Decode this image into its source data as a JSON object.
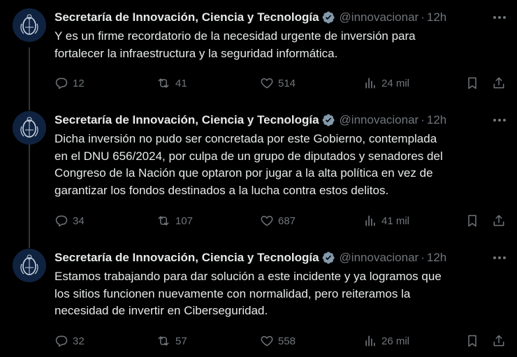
{
  "tweets": [
    {
      "author": "Secretaría de Innovación, Ciencia y Tecnología",
      "handle": "@innovacionar",
      "separator": "·",
      "time": "12h",
      "text": "Y es un firme recordatorio de la necesidad urgente de inversión para\nfortalecer la infraestructura y la seguridad informática.",
      "replies": "12",
      "reposts": "41",
      "likes": "514",
      "views": "24 mil"
    },
    {
      "author": "Secretaría de Innovación, Ciencia y Tecnología",
      "handle": "@innovacionar",
      "separator": "·",
      "time": "12h",
      "text": "Dicha inversión no pudo ser concretada por este Gobierno, contemplada\nen el DNU 656/2024, por culpa de un grupo de diputados y senadores del\nCongreso de la Nación que optaron por jugar a la alta política en vez de\ngarantizar los fondos destinados a la lucha contra estos delitos.",
      "replies": "34",
      "reposts": "107",
      "likes": "687",
      "views": "41 mil"
    },
    {
      "author": "Secretaría de Innovación, Ciencia y Tecnología",
      "handle": "@innovacionar",
      "separator": "·",
      "time": "12h",
      "text": "Estamos trabajando para dar solución a este incidente y ya logramos que\nlos sitios funcionen nuevamente con normalidad, pero reiteramos la\nnecesidad de invertir en Ciberseguridad.",
      "replies": "32",
      "reposts": "57",
      "likes": "558",
      "views": "26 mil"
    }
  ],
  "icons": {
    "verified": "verified-badge-icon",
    "more": "more-options-icon",
    "reply": "reply-icon",
    "repost": "repost-icon",
    "like": "like-icon",
    "views": "views-icon",
    "bookmark": "bookmark-icon",
    "share": "share-icon"
  },
  "colors": {
    "background": "#000000",
    "text": "#e7e9ea",
    "secondary": "#71767b",
    "verified": "#829aab",
    "thread_line": "#333639",
    "avatar": "#10243e"
  }
}
